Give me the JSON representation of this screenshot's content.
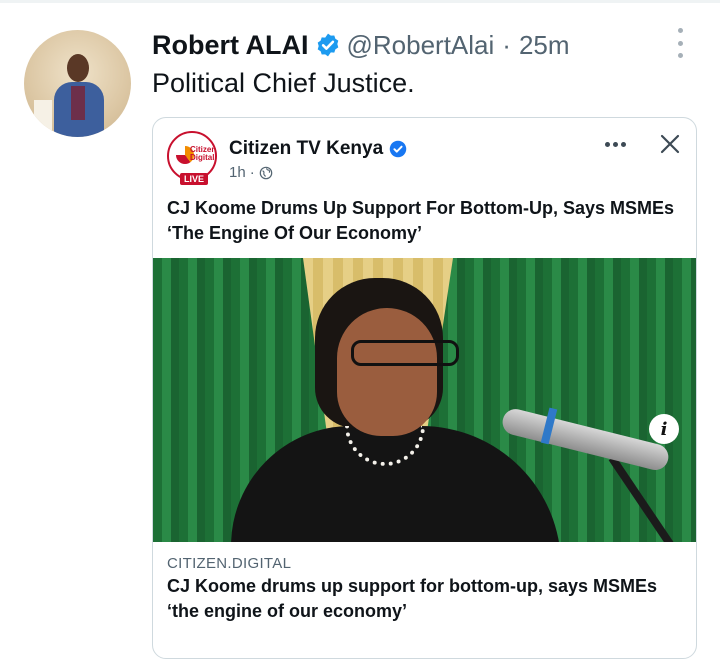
{
  "tweet": {
    "author_name": "Robert ALAI",
    "handle": "@RobertAlai",
    "separator": "·",
    "time": "25m",
    "text": "Political Chief Justice."
  },
  "embed": {
    "page_name": "Citizen TV Kenya",
    "logo_text": "Citizen Digital",
    "logo_badge": "LIVE",
    "time": "1h",
    "meta_separator": "·",
    "headline": "CJ Koome Drums Up Support For Bottom-Up, Says MSMEs ‘The Engine Of Our Economy’",
    "info_symbol": "i",
    "link_domain": "CITIZEN.DIGITAL",
    "link_title": "CJ Koome drums up support for bottom-up, says MSMEs ‘the engine of our economy’"
  },
  "icons": {
    "verified": "verified-badge-icon",
    "more": "more-options-icon",
    "close": "close-icon",
    "globe": "globe-icon",
    "info": "info-icon"
  },
  "colors": {
    "verified_blue": "#1d9bf0",
    "text_secondary": "#536471",
    "border": "#cfd9de",
    "citizen_red": "#c8102e"
  }
}
